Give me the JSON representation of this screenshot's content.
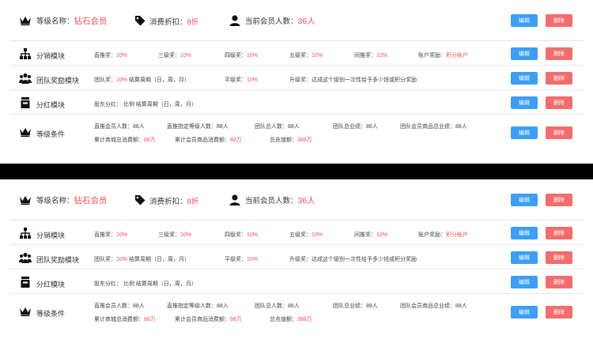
{
  "panels": [
    {
      "header": {
        "level_label": "等级名称：",
        "level_value": "钻石会员",
        "discount_label": "消费折扣：",
        "discount_value": "8折",
        "members_label": "当前会员人数：",
        "members_value": "36人",
        "edit_label": "编辑",
        "delete_label": "删除"
      },
      "distribution": {
        "title": "分销模块",
        "items": [
          {
            "label": "直推奖：",
            "value": "10%"
          },
          {
            "label": "三级奖：",
            "value": "10%"
          },
          {
            "label": "四级奖：",
            "value": "10%"
          },
          {
            "label": "五级奖：",
            "value": "10%"
          },
          {
            "label": "间推奖：",
            "value": "10%"
          },
          {
            "label": "账户奖励：",
            "value": "积分账户"
          }
        ],
        "edit_label": "编辑",
        "delete_label": "删除"
      },
      "team": {
        "title": "团队奖励模块",
        "bonus_label": "团队奖：",
        "bonus_value": "10%",
        "bonus_cycle": "结算周期（日，周，月）",
        "flat_label": "平级奖：",
        "flat_value": "10%",
        "upgrade_text": "升级奖：达成这个级别一次性给予多少钱或积分奖励",
        "edit_label": "编辑",
        "delete_label": "删除"
      },
      "dividend": {
        "title": "分红模块",
        "text": "股东分红：  比例  结算周期（日，周，月）",
        "edit_label": "编辑",
        "delete_label": "删除"
      },
      "conditions": {
        "title": "等级条件",
        "line1": [
          "直推会员人数：88人",
          "直推指定等级人数：88人",
          "团队总人数：88人",
          "团队总业绩：88人",
          "团队会员商品总业绩：88人"
        ],
        "line2": [
          {
            "label": "累计商城总消费额：",
            "value": "88万"
          },
          {
            "label": "累计会员商品消费额：",
            "value": "88万"
          },
          {
            "label": "总充值额：",
            "value": "388万"
          }
        ],
        "edit_label": "编辑",
        "delete_label": "删除"
      }
    },
    {
      "header": {
        "level_label": "等级名称：",
        "level_value": "钻石会员",
        "discount_label": "消费折扣：",
        "discount_value": "8折",
        "members_label": "当前会员人数：",
        "members_value": "36人",
        "edit_label": "编辑",
        "delete_label": "删除"
      },
      "distribution": {
        "title": "分销模块",
        "items": [
          {
            "label": "直推奖：",
            "value": "10%"
          },
          {
            "label": "三级奖：",
            "value": "10%"
          },
          {
            "label": "四级奖：",
            "value": "10%"
          },
          {
            "label": "五级奖：",
            "value": "10%"
          },
          {
            "label": "间推奖：",
            "value": "10%"
          },
          {
            "label": "账户奖励：",
            "value": "积分账户"
          }
        ],
        "edit_label": "编辑",
        "delete_label": "删除"
      },
      "team": {
        "title": "团队奖励模块",
        "bonus_label": "团队奖：",
        "bonus_value": "10%",
        "bonus_cycle": "结算周期（日，周，月）",
        "flat_label": "平级奖：",
        "flat_value": "10%",
        "upgrade_text": "升级奖：达成这个级别一次性给予多少钱或积分奖励",
        "edit_label": "编辑",
        "delete_label": "删除"
      },
      "dividend": {
        "title": "分红模块",
        "text": "股东分红：  比例  结算周期（日，周，月）",
        "edit_label": "编辑",
        "delete_label": "删除"
      },
      "conditions": {
        "title": "等级条件",
        "line1": [
          "直推会员人数：88人",
          "直推指定等级人数：88人",
          "团队总人数：88人",
          "团队总业绩：88人",
          "团队会员商品总业绩：88人"
        ],
        "line2": [
          {
            "label": "累计商城总消费额：",
            "value": "88万"
          },
          {
            "label": "累计会员商品消费额：",
            "value": "88万"
          },
          {
            "label": "总充值额：",
            "value": "388万"
          }
        ],
        "edit_label": "编辑",
        "delete_label": "删除"
      }
    }
  ],
  "icons": {
    "header": "crown-icon",
    "discount": "tag-icon",
    "members": "user-icon",
    "distribution": "hierarchy-icon",
    "team": "group-icon",
    "dividend": "cash-register-icon",
    "conditions": "crown-icon"
  },
  "colors": {
    "accent_red": "#f2515a",
    "edit_button": "#3d9ef5",
    "delete_button": "#f26d6d"
  }
}
